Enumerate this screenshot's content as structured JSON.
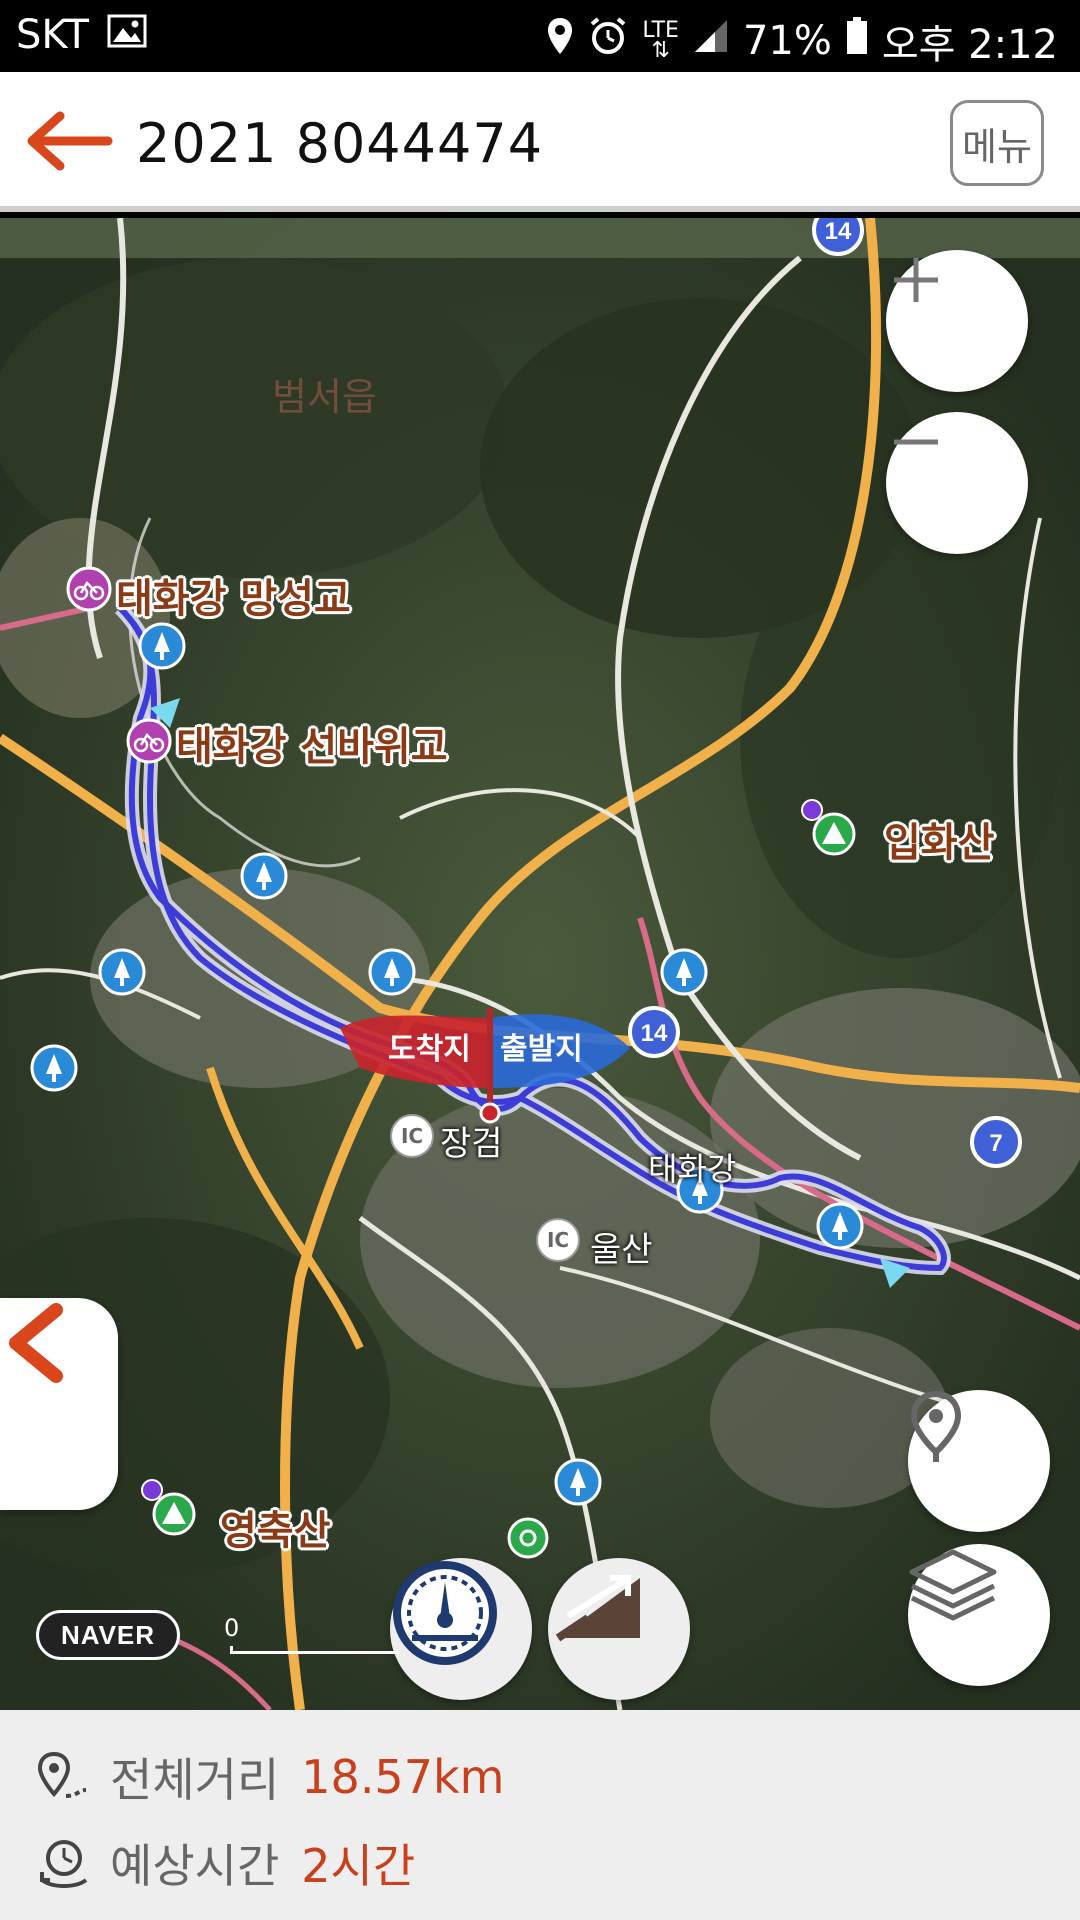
{
  "status_bar": {
    "carrier": "SKT",
    "network": "LTE",
    "battery": "71%",
    "time": "오후 2:12"
  },
  "header": {
    "title": "2021 8044474",
    "menu_label": "메뉴"
  },
  "map": {
    "place_labels": {
      "beomseo": "범서읍",
      "manseong": "태화강 망성교",
      "seonbawi": "태화강 선바위교",
      "iphwasan": "입화산",
      "yeongchuksan": "영축산",
      "jangeom": "장검",
      "ulsan": "울산",
      "taehwa": "태화강"
    },
    "ic_label": "IC",
    "route_numbers": [
      "14",
      "14",
      "7"
    ],
    "arrival_flag": "도착지",
    "departure_flag": "출발지",
    "naver_logo": "NAVER",
    "scale": "0"
  },
  "footer": {
    "distance_label": "전체거리",
    "distance_value": "18.57km",
    "time_label": "예상시간",
    "time_value": "2시간"
  },
  "colors": {
    "accent": "#c9401c",
    "route": "#3c3cd8"
  }
}
